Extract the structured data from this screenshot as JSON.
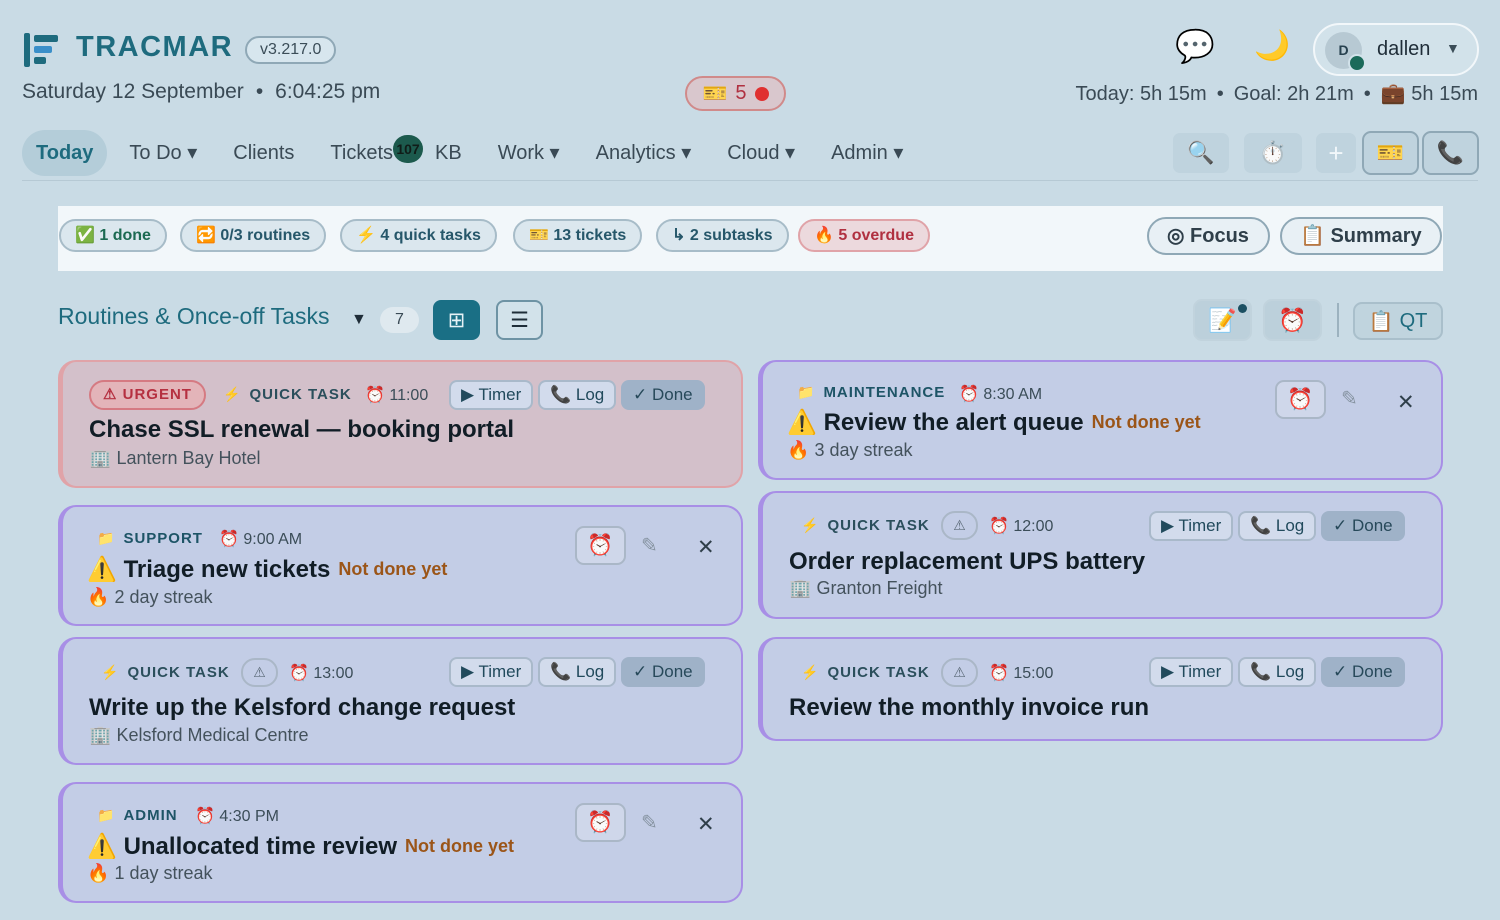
{
  "header": {
    "brand": "TRACMAR",
    "version": "v3.217.0",
    "date": "Saturday 12 September",
    "time": "6:04:25 pm",
    "ticket_alert_icon": "🎫",
    "ticket_alert_count": "5",
    "user": {
      "initial": "D",
      "name": "dallen"
    },
    "stats": {
      "today": "Today: 5h 15m",
      "goal": "Goal: 2h 21m",
      "work_icon": "💼",
      "work": "5h 15m"
    },
    "colors": {
      "brand": "#1e6b7e",
      "accent": "#1a6f85",
      "alert": "#e03030"
    }
  },
  "nav": {
    "items": [
      {
        "label": "Today",
        "active": true
      },
      {
        "label": "To Do ▾"
      },
      {
        "label": "Clients"
      },
      {
        "label": "Tickets",
        "badge": "107"
      },
      {
        "label": "KB"
      },
      {
        "label": "Work ▾"
      },
      {
        "label": "Analytics ▾"
      },
      {
        "label": "Cloud ▾"
      },
      {
        "label": "Admin ▾"
      }
    ],
    "tools": [
      {
        "icon": "🔍",
        "name": "search-icon"
      },
      {
        "icon": "⏱️",
        "name": "stopwatch-icon"
      },
      {
        "icon": "+",
        "name": "plus-icon"
      },
      {
        "icon": "🎫",
        "name": "ticket-icon"
      },
      {
        "icon": "📞",
        "name": "phone-icon"
      }
    ]
  },
  "summary": {
    "chips": [
      {
        "icon": "✅",
        "label": "1 done"
      },
      {
        "icon": "🔁",
        "label": "0/3 routines"
      },
      {
        "icon": "⚡",
        "label": "4 quick tasks"
      },
      {
        "icon": "🎫",
        "label": "13 tickets"
      },
      {
        "icon": "↳",
        "label": "2 subtasks"
      },
      {
        "icon": "🔥",
        "label": "5 overdue"
      }
    ],
    "focus": "◎ Focus",
    "summary_btn": "📋 Summary"
  },
  "section": {
    "title": "Routines & Once-off Tasks",
    "count": "7",
    "qt_label": "QT"
  },
  "cards": {
    "c1": {
      "urgent": "⚠ URGENT",
      "tag": "QUICK TASK",
      "time": "⏰ 11:00",
      "title": "Chase SSL renewal — booking portal",
      "client": "Lantern Bay Hotel"
    },
    "c2": {
      "tag": "SUPPORT",
      "time": "⏰ 9:00 AM",
      "title": "Triage new tickets",
      "status": "Not done yet",
      "streak": "2 day streak"
    },
    "c3": {
      "tag": "QUICK TASK",
      "time": "⏰ 13:00",
      "title": "Write up the Kelsford change request",
      "client": "Kelsford Medical Centre"
    },
    "c4": {
      "tag": "ADMIN",
      "time": "⏰ 4:30 PM",
      "title": "Unallocated time review",
      "status": "Not done yet",
      "streak": "1 day streak"
    },
    "c5": {
      "tag": "MAINTENANCE",
      "time": "⏰ 8:30 AM",
      "title": "Review the alert queue",
      "status": "Not done yet",
      "streak": "3 day streak"
    },
    "c6": {
      "tag": "QUICK TASK",
      "time": "⏰ 12:00",
      "title": "Order replacement UPS battery",
      "client": "Granton Freight"
    },
    "c7": {
      "tag": "QUICK TASK",
      "time": "⏰ 15:00",
      "title": "Review the monthly invoice run"
    }
  },
  "actions": {
    "timer": "▶ Timer",
    "log": "📞 Log",
    "done": "✓ Done"
  }
}
